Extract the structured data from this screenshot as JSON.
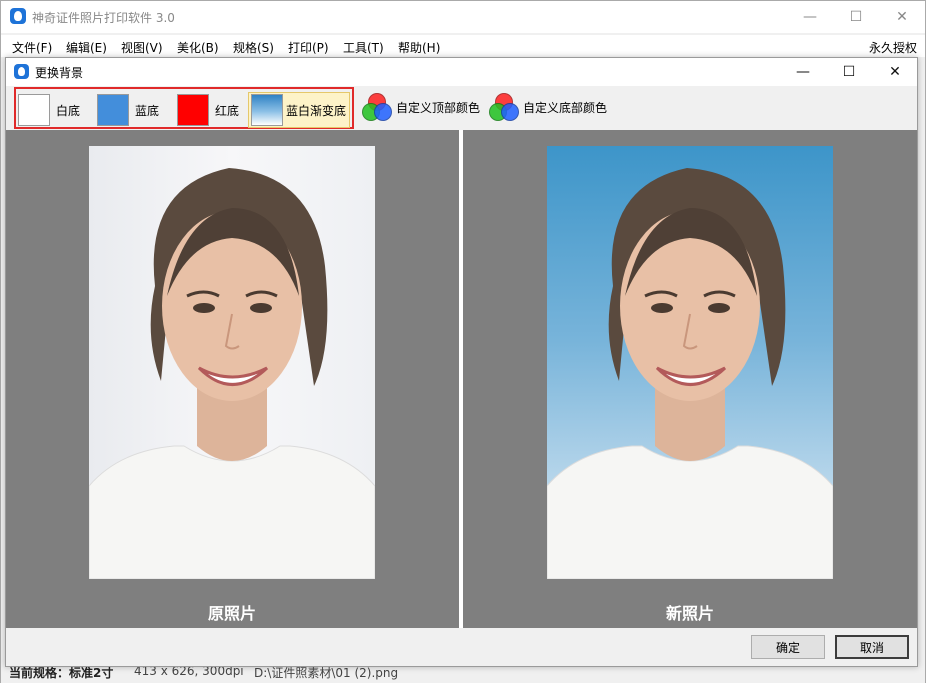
{
  "app": {
    "title": "神奇证件照片打印软件 3.0",
    "license_label": "永久授权",
    "menus": [
      "文件(F)",
      "编辑(E)",
      "视图(V)",
      "美化(B)",
      "规格(S)",
      "打印(P)",
      "工具(T)",
      "帮助(H)"
    ]
  },
  "window_controls": {
    "minimize": "—",
    "maximize": "☐",
    "close": "✕"
  },
  "dialog": {
    "title": "更换背景",
    "presets": [
      {
        "label": "白底",
        "color": "#ffffff"
      },
      {
        "label": "蓝底",
        "color": "#438edb"
      },
      {
        "label": "红底",
        "color": "#ff0000"
      },
      {
        "label": "蓝白渐变底",
        "color": "gradient-blue-white",
        "selected": true
      }
    ],
    "custom_top_label": "自定义顶部颜色",
    "custom_bottom_label": "自定义底部颜色",
    "original_caption": "原照片",
    "new_caption": "新照片",
    "ok_label": "确定",
    "cancel_label": "取消"
  },
  "statusbar": {
    "spec": "当前规格：标准2寸",
    "size": "413 x 626, 300dpi",
    "path": "D:\\证件照素材\\01 (2).png"
  },
  "colors": {
    "selection_outline": "#e02a2a",
    "canvas_bg": "#7f7f7f",
    "selected_bg": "#fdf3c8"
  }
}
